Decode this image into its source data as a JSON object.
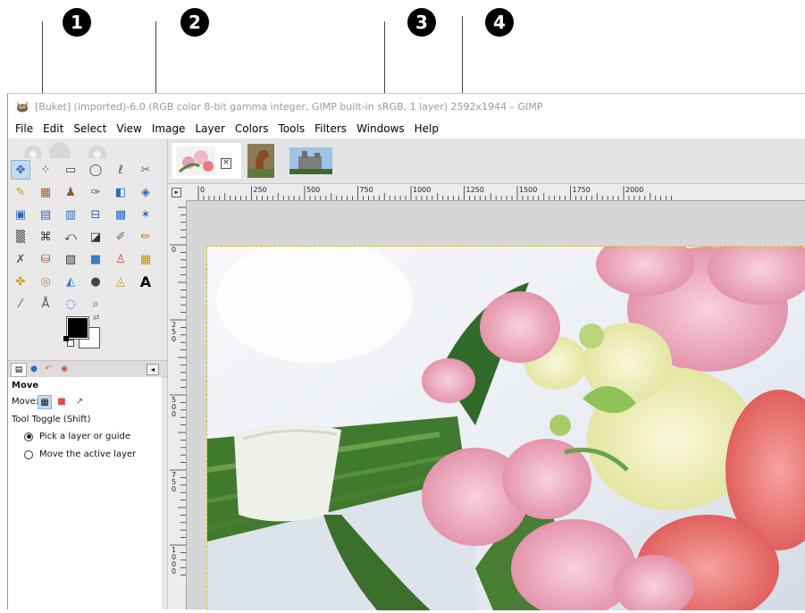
{
  "callouts": [
    "1",
    "2",
    "3",
    "4"
  ],
  "window": {
    "title": "[Buket] (imported)-6.0 (RGB color 8-bit gamma integer, GIMP built-in sRGB, 1 layer) 2592x1944 – GIMP"
  },
  "menu": {
    "items": [
      "File",
      "Edit",
      "Select",
      "View",
      "Image",
      "Layer",
      "Colors",
      "Tools",
      "Filters",
      "Windows",
      "Help"
    ]
  },
  "toolbox": {
    "tools": [
      "move-icon",
      "align-icon",
      "rect-select-icon",
      "ellipse-select-icon",
      "free-select-icon",
      "fuzzy-select-icon",
      "select-by-color-icon",
      "scissors-icon",
      "foreground-select-icon",
      "paths-icon",
      "color-picker-icon",
      "zoom-icon",
      "measure-icon",
      "crop-icon",
      "unified-transform-icon",
      "rotate-icon",
      "scale-icon",
      "shear-icon",
      "perspective-icon",
      "3d-transform-icon",
      "warp-icon",
      "flip-icon",
      "cage-icon",
      "bucket-fill-icon",
      "blend-icon",
      "paintbrush-icon",
      "pencil-icon",
      "airbrush-icon",
      "ink-icon",
      "mypaint-icon",
      "clone-icon",
      "heal-icon",
      "perspective-clone-icon",
      "blur-icon",
      "smudge-icon",
      "dodge-burn-icon",
      "text-icon",
      "eraser-icon",
      "gegl-icon",
      "magnify-icon"
    ],
    "foreground_color": "#000000",
    "background_color": "#ffffff"
  },
  "tool_options": {
    "title": "Move",
    "mode_label": "Move:",
    "toggle_label": "Tool Toggle  (Shift)",
    "options": [
      "Pick a layer or guide",
      "Move the active layer"
    ],
    "selected_option": 0
  },
  "image_tabs": [
    "Buket",
    "Horse",
    "Castle"
  ],
  "rulers": {
    "horizontal": [
      "0",
      "250",
      "500",
      "750",
      "1000",
      "1250",
      "1500",
      "1750",
      "2000"
    ],
    "vertical": [
      "0",
      "250",
      "500",
      "750",
      "1000"
    ]
  },
  "colors": {
    "accent": "#c5d9f1",
    "selection_border": "#d7c400"
  }
}
